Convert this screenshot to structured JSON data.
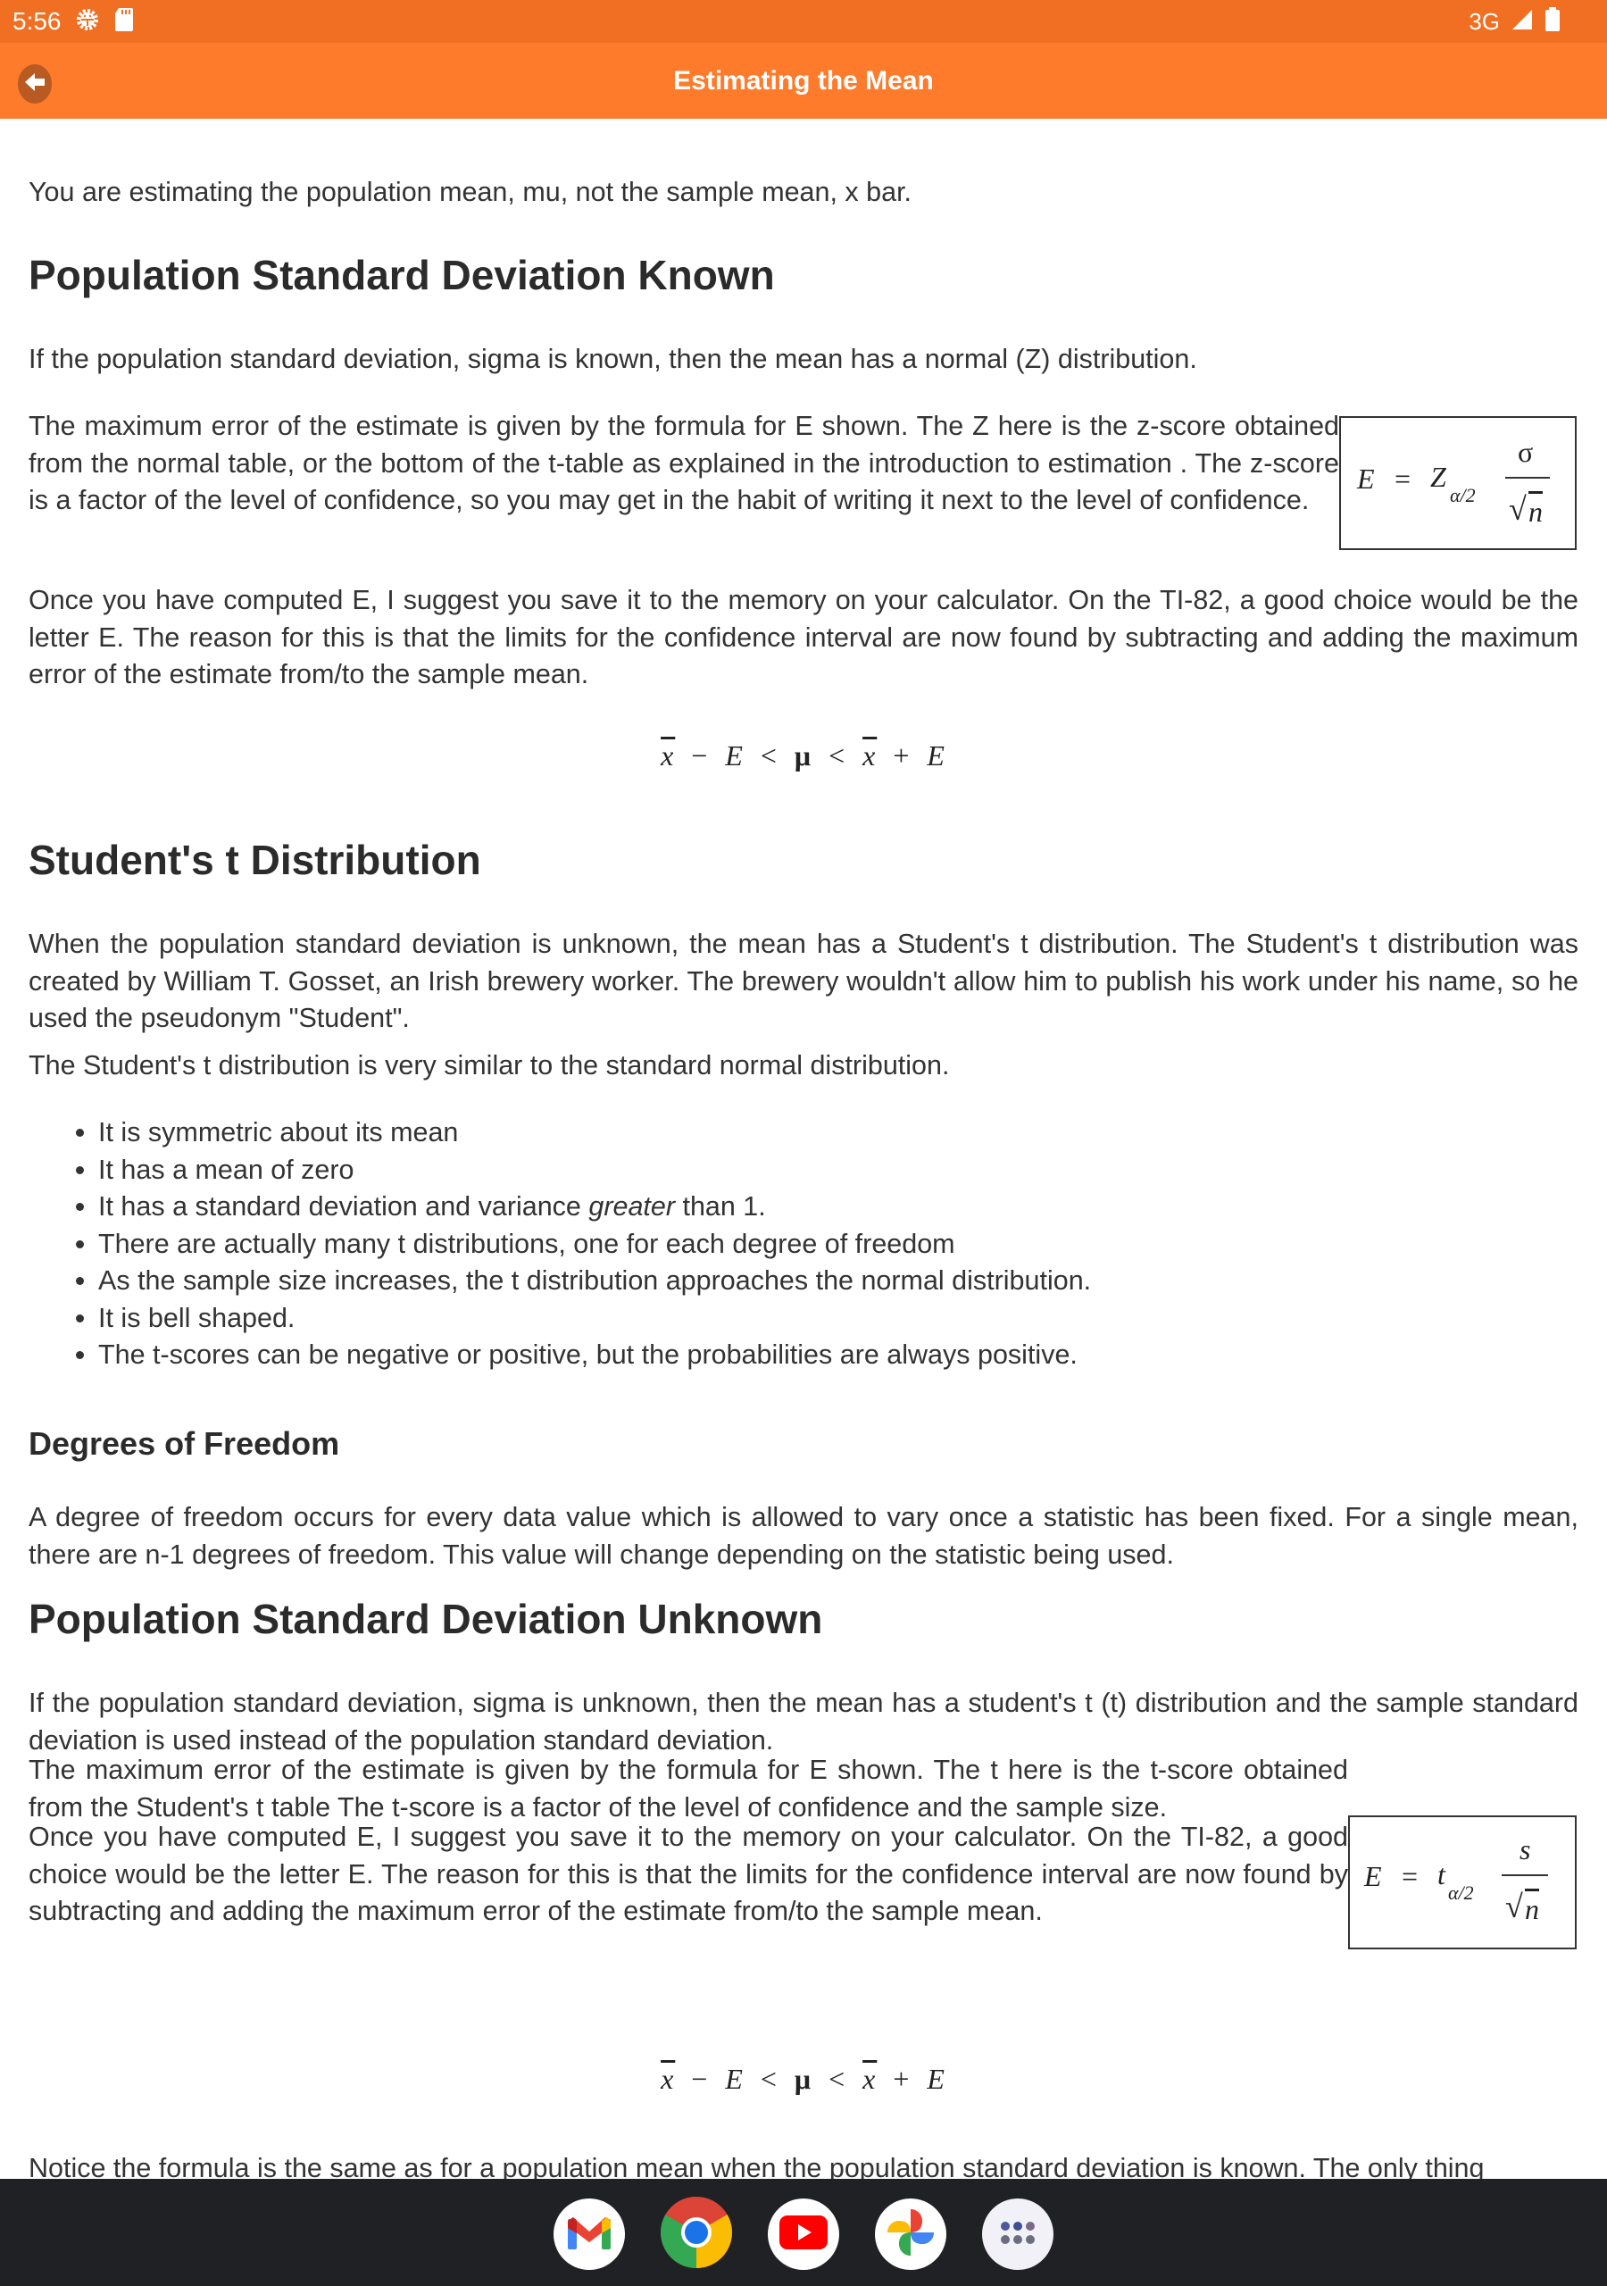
{
  "status_bar": {
    "time": "5:56",
    "network": "3G",
    "icons": [
      "settings-gear-icon",
      "sd-card-icon",
      "signal-icon",
      "battery-icon"
    ]
  },
  "app_bar": {
    "title": "Estimating the Mean",
    "back_icon": "arrow-left-icon"
  },
  "article": {
    "intro": "You are estimating the population mean, mu, not the sample mean, x bar.",
    "section_known": {
      "heading": "Population Standard Deviation Known",
      "p1": "If the population standard deviation, sigma is known, then the mean has a normal (Z) distribution.",
      "p2": "The maximum error of the estimate is given by the formula for E shown. The Z here is the z-score obtained from the normal table, or the bottom of the t-table as explained in the introduction to estimation . The z-score is a factor of the level of confidence, so you may get in the habit of writing it next to the level of confidence.",
      "formula": {
        "lhs": "E",
        "eq": "=",
        "coef": "Z",
        "sub": "α/2",
        "num": "σ",
        "den_root": "√",
        "den": "n"
      },
      "p3": "Once you have computed E, I suggest you save it to the memory on your calculator. On the TI-82, a good choice would be the letter E. The reason for this is that the limits for the confidence interval are now found by subtracting and adding the maximum error of the estimate from/to the sample mean.",
      "interval": {
        "xbar": "x",
        "minus": "−",
        "E": "E",
        "lt": "<",
        "mu": "μ",
        "plus": "+"
      }
    },
    "section_t": {
      "heading": "Student's t Distribution",
      "p1": "When the population standard deviation is unknown, the mean has a Student's t distribution. The Student's t distribution was created by William T. Gosset, an Irish brewery worker. The brewery wouldn't allow him to publish his work under his name, so he used the pseudonym \"Student\".",
      "p2": "The Student's t distribution is very similar to the standard normal distribution.",
      "bullets": [
        {
          "text": "It is symmetric about its mean"
        },
        {
          "text": "It has a mean of zero"
        },
        {
          "pre": "It has a standard deviation and variance ",
          "em": "greater",
          "post": " than 1."
        },
        {
          "text": "There are actually many t distributions, one for each degree of freedom"
        },
        {
          "text": "As the sample size increases, the t distribution approaches the normal distribution."
        },
        {
          "text": "It is bell shaped."
        },
        {
          "text": "The t-scores can be negative or positive, but the probabilities are always positive."
        }
      ]
    },
    "section_df": {
      "heading": "Degrees of Freedom",
      "p1": "A degree of freedom occurs for every data value which is allowed to vary once a statistic has been fixed. For a single mean, there are n-1 degrees of freedom. This value will change depending on the statistic being used."
    },
    "section_unknown": {
      "heading": "Population Standard Deviation Unknown",
      "p1": "If the population standard deviation, sigma is unknown, then the mean has a student's t (t) distribution and the sample standard deviation is used instead of the population standard deviation.",
      "p2": "The maximum error of the estimate is given by the formula for E shown. The t here is the t-score obtained from the Student's t table The t-score is a factor of the level of confidence and the sample size.",
      "formula": {
        "lhs": "E",
        "eq": "=",
        "coef": "t",
        "sub": "α/2",
        "num": "s",
        "den_root": "√",
        "den": "n"
      },
      "p3": "Once you have computed E, I suggest you save it to the memory on your calculator. On the TI-82, a good choice would be the letter E. The reason for this is that the limits for the confidence interval are now found by subtracting and adding the maximum error of the estimate from/to the sample mean.",
      "interval": {
        "xbar": "x",
        "minus": "−",
        "E": "E",
        "lt": "<",
        "mu": "μ",
        "plus": "+"
      },
      "p4_partial": "Notice the formula is the same as for a population mean when the population standard deviation is known. The only thing"
    }
  },
  "dock": {
    "apps": [
      "Gmail",
      "Chrome",
      "YouTube",
      "Photos",
      "App drawer"
    ]
  },
  "colors": {
    "status_bar": "#f06f22",
    "app_bar": "#fe7b2b",
    "back_button": "#b85a22",
    "nav_bar": "#202124",
    "text": "#333333"
  }
}
